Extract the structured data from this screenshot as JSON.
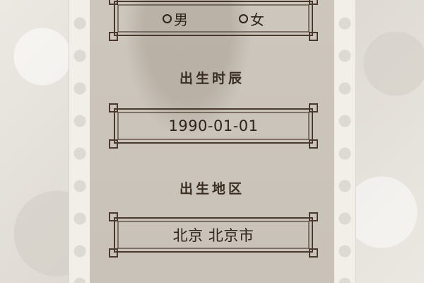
{
  "gender": {
    "options": [
      {
        "label": "男",
        "selected": false
      },
      {
        "label": "女",
        "selected": false
      }
    ]
  },
  "birth_time": {
    "label": "出生时辰",
    "value": "1990-01-01"
  },
  "birth_region": {
    "label": "出生地区",
    "value": "北京 北京市"
  },
  "colors": {
    "frame_line": "#4a3a2e",
    "panel_bg": "#cbc4bb",
    "text": "#2e241c"
  }
}
